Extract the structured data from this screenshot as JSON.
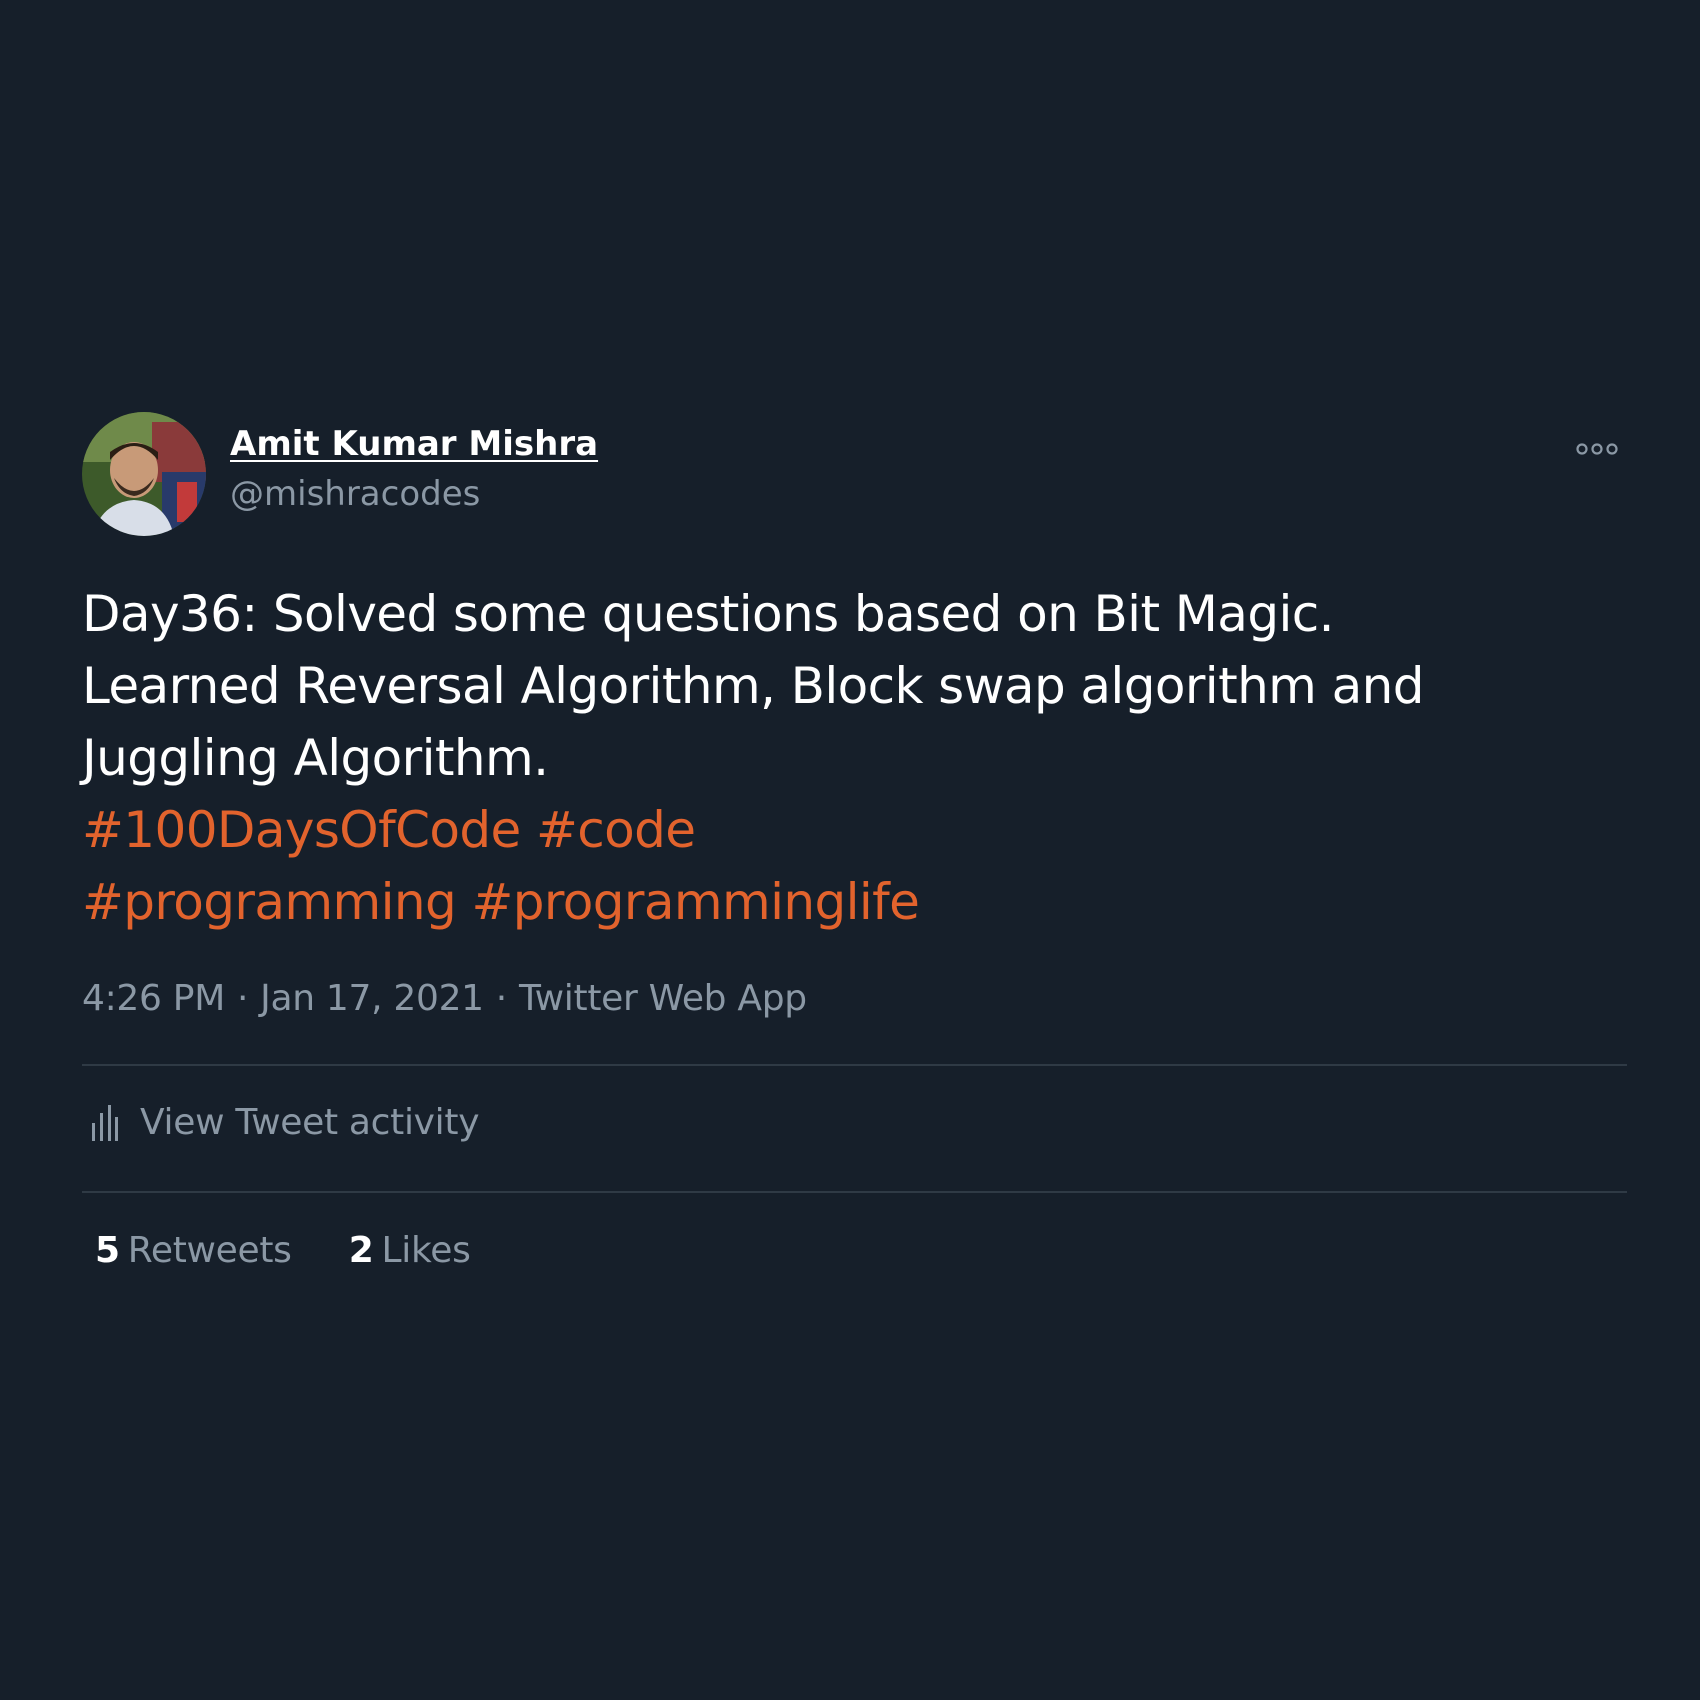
{
  "tweet": {
    "author": {
      "name": "Amit Kumar Mishra",
      "handle": "@mishracodes"
    },
    "text_lines": [
      "Day36: Solved some questions based on Bit Magic.",
      "Learned Reversal Algorithm, Block swap algorithm and",
      "Juggling Algorithm."
    ],
    "hashtags": [
      "#100DaysOfCode",
      "#code",
      "#programming",
      "#programminglife"
    ],
    "time": "4:26 PM",
    "date": "Jan 17, 2021",
    "source": "Twitter Web App",
    "separator": "·",
    "activity_label": "View Tweet activity",
    "stats": {
      "retweets_count": "5",
      "retweets_label": "Retweets",
      "likes_count": "2",
      "likes_label": "Likes"
    }
  },
  "icons": {
    "more": "more-options-icon",
    "activity": "bar-chart-icon"
  },
  "colors": {
    "background": "#161f2a",
    "hashtag": "#e2632d",
    "secondary_text": "#8b98a5",
    "primary_text": "#ffffff",
    "divider": "#2f3a45"
  }
}
